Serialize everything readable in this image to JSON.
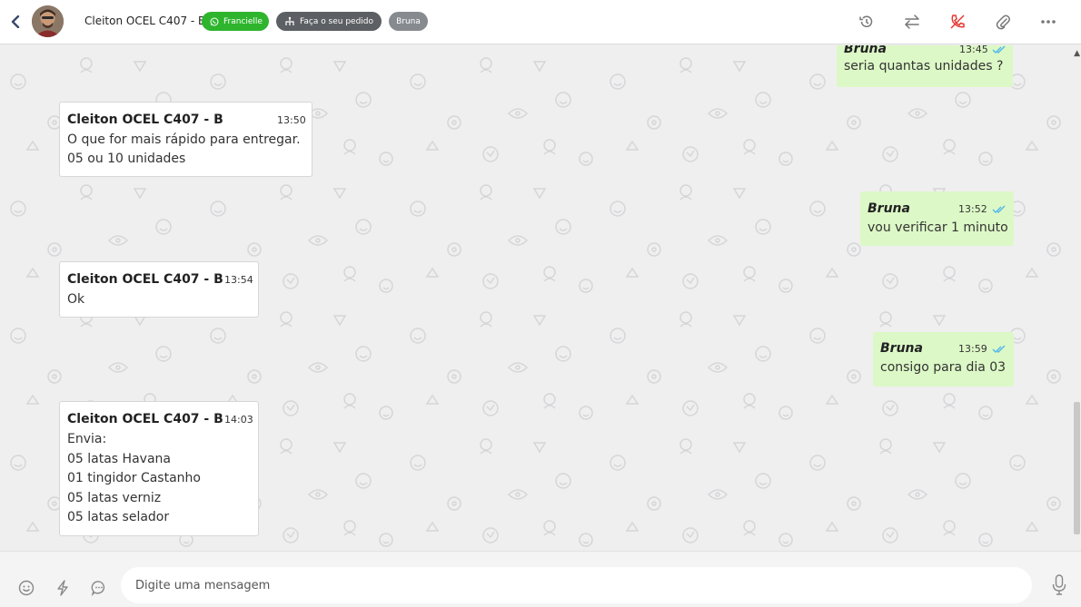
{
  "header": {
    "contact_name": "Cleiton OCEL C407 - B",
    "tag_whatsapp": "Francielle",
    "tag_order": "Faça o seu pedido",
    "tag_agent": "Bruna"
  },
  "icons": {
    "back": "chevron-left-icon",
    "history": "history-icon",
    "transfer": "transfer-icon",
    "end_call": "phone-hangup-icon",
    "attach": "paperclip-icon",
    "more": "more-horizontal-icon",
    "emoji": "emoji-icon",
    "quick_reply": "lightning-icon",
    "chat": "chat-bubble-icon",
    "mic": "microphone-icon"
  },
  "colors": {
    "incoming_bg": "#ffffff",
    "outgoing_bg": "#dcf8c6",
    "whatsapp_green": "#2eb52d",
    "read_tick": "#4fb6ec",
    "hangup_red": "#e53935"
  },
  "messages": [
    {
      "direction": "out",
      "sender": "Bruna",
      "time": "13:45",
      "status": "read",
      "lines": [
        "seria quantas unidades ?"
      ]
    },
    {
      "direction": "in",
      "sender": "Cleiton OCEL C407 - B",
      "time": "13:50",
      "lines": [
        "O que for mais rápido para entregar.",
        "05 ou 10 unidades"
      ]
    },
    {
      "direction": "out",
      "sender": "Bruna",
      "time": "13:52",
      "status": "read",
      "lines": [
        "vou verificar 1 minuto"
      ]
    },
    {
      "direction": "in",
      "sender": "Cleiton OCEL C407 - B",
      "time": "13:54",
      "lines": [
        "Ok"
      ]
    },
    {
      "direction": "out",
      "sender": "Bruna",
      "time": "13:59",
      "status": "read",
      "lines": [
        "consigo para dia 03"
      ]
    },
    {
      "direction": "in",
      "sender": "Cleiton OCEL C407 - B",
      "time": "14:03",
      "lines": [
        "Envia:",
        "05 latas Havana",
        "01 tingidor Castanho",
        "05 latas verniz",
        "05 latas selador"
      ]
    }
  ],
  "composer": {
    "placeholder": "Digite uma mensagem"
  }
}
